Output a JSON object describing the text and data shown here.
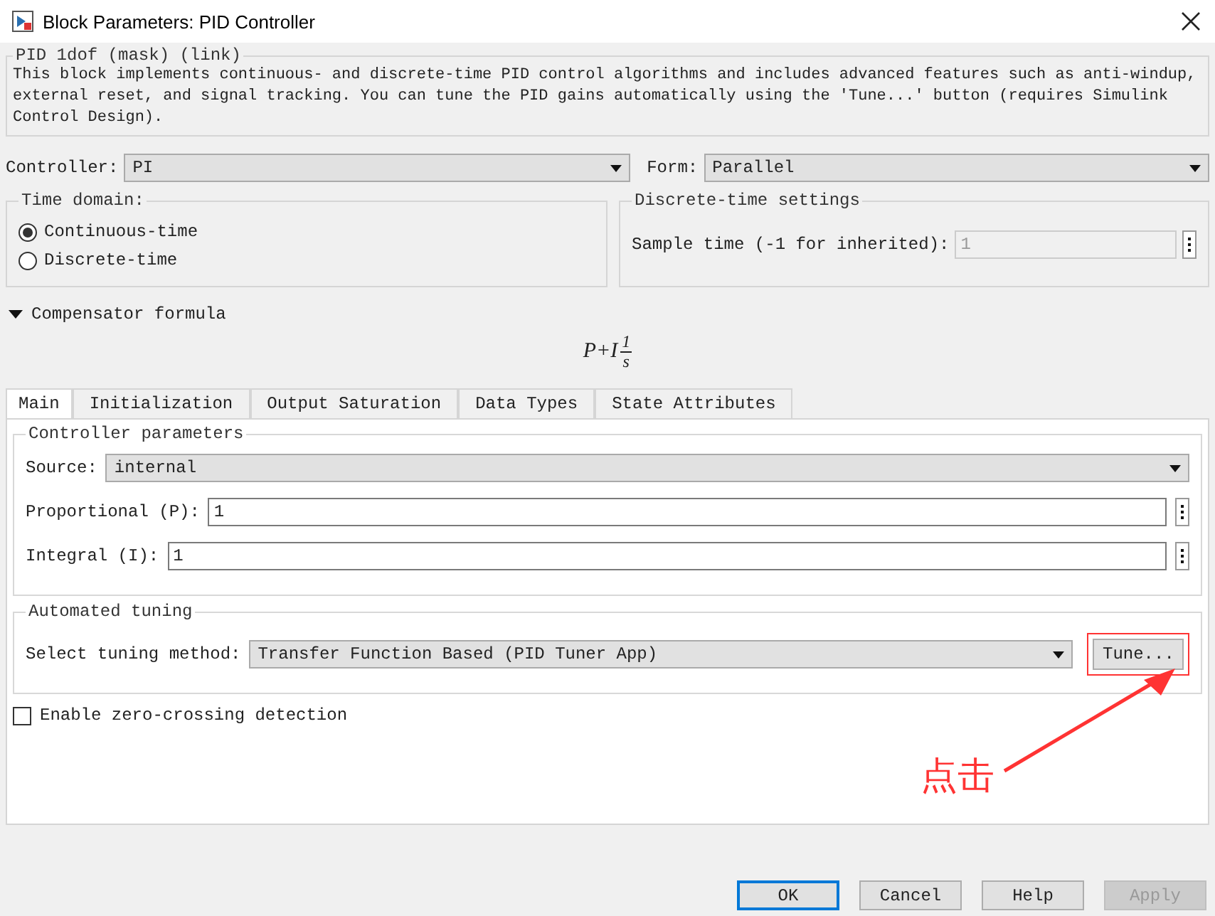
{
  "window": {
    "title": "Block Parameters: PID Controller"
  },
  "mask": {
    "title": "PID 1dof (mask) (link)",
    "description": "This block implements continuous- and discrete-time PID control algorithms and includes advanced features such as anti-windup, external reset, and signal tracking. You can tune the PID gains automatically using the 'Tune...' button (requires Simulink Control Design)."
  },
  "controller": {
    "label": "Controller:",
    "value": "PI"
  },
  "form": {
    "label": "Form:",
    "value": "Parallel"
  },
  "time_domain": {
    "title": "Time domain:",
    "options": [
      {
        "label": "Continuous-time",
        "selected": true
      },
      {
        "label": "Discrete-time",
        "selected": false
      }
    ]
  },
  "discrete_settings": {
    "title": "Discrete-time settings",
    "label": "Sample time (-1 for inherited):",
    "value": "1",
    "disabled": true
  },
  "compensator": {
    "label": "Compensator formula",
    "expanded": true,
    "formula": {
      "lhs": "P+I",
      "numerator": "1",
      "denominator": "s"
    }
  },
  "tabs": [
    {
      "label": "Main",
      "selected": true
    },
    {
      "label": "Initialization",
      "selected": false
    },
    {
      "label": "Output Saturation",
      "selected": false
    },
    {
      "label": "Data Types",
      "selected": false
    },
    {
      "label": "State Attributes",
      "selected": false
    }
  ],
  "controller_parameters": {
    "title": "Controller parameters",
    "source": {
      "label": "Source:",
      "value": "internal"
    },
    "fields": [
      {
        "label": "Proportional (P):",
        "value": "1"
      },
      {
        "label": "Integral (I):",
        "value": "1"
      }
    ]
  },
  "automated_tuning": {
    "title": "Automated tuning",
    "label": "Select tuning method:",
    "value": "Transfer Function Based (PID Tuner App)",
    "button": "Tune..."
  },
  "zero_crossing": {
    "label": "Enable zero-crossing detection",
    "checked": false
  },
  "annotation": {
    "text": "点击"
  },
  "buttons": [
    {
      "label": "OK",
      "disabled": false,
      "default": true
    },
    {
      "label": "Cancel",
      "disabled": false,
      "default": false
    },
    {
      "label": "Help",
      "disabled": false,
      "default": false
    },
    {
      "label": "Apply",
      "disabled": true,
      "default": false
    }
  ]
}
